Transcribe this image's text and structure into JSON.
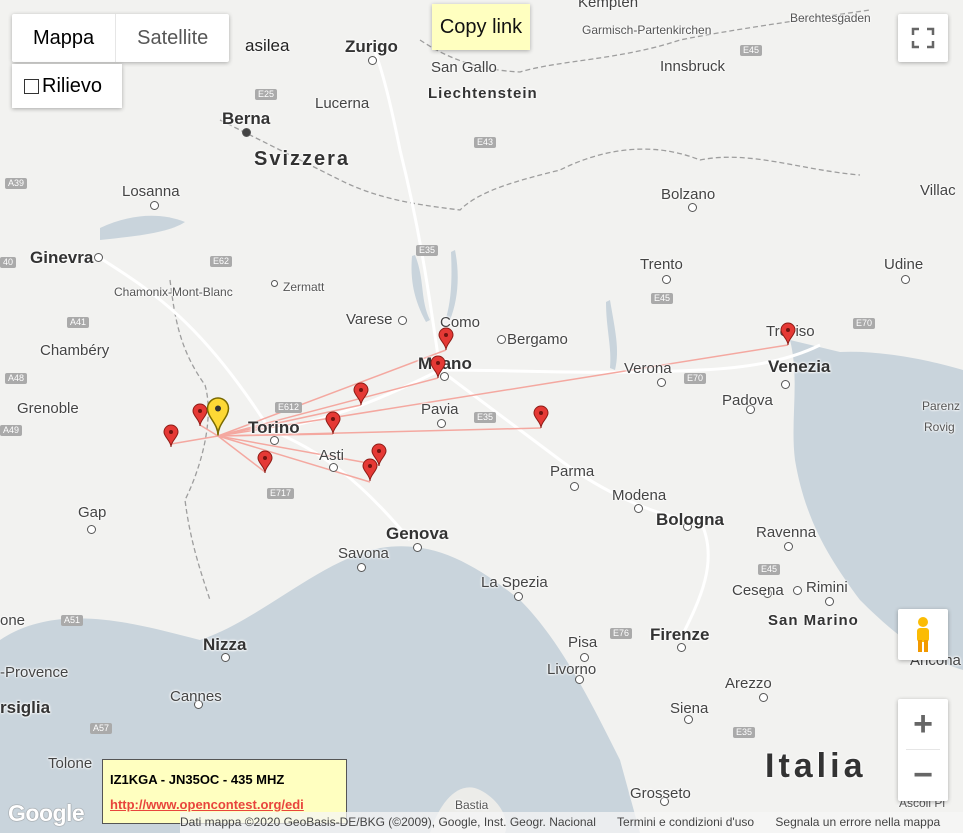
{
  "map_type": {
    "map_label": "Mappa",
    "satellite_label": "Satellite",
    "selected": "Mappa"
  },
  "terrain": {
    "label": "Rilievo",
    "checked": false
  },
  "copy_link": "Copy link",
  "info": {
    "title": "IZ1KGA - JN35OC - 435 MHZ",
    "link": "http://www.opencontest.org/edi"
  },
  "logo": "Google",
  "attribution": {
    "data": "Dati mappa ©2020 GeoBasis-DE/BKG (©2009), Google, Inst. Geogr. Nacional",
    "terms": "Termini e condizioni d'uso",
    "report": "Segnala un errore nella mappa"
  },
  "controls": {
    "zoom_in": "+",
    "zoom_out": "−"
  },
  "colors": {
    "info_bg": "#ffffc0",
    "link": "#e8453c",
    "marker_red": "#e53935",
    "marker_home": "#fdd835",
    "path": "#f4a8a0",
    "sea": "#c9d4dc"
  },
  "labels": {
    "kempten": "Kempten",
    "berchtesgaden": "Berchtesgaden",
    "basilea": "asilea",
    "zurigo": "Zurigo",
    "garmisch": "Garmisch-Partenkirchen",
    "sangallo": "San Gallo",
    "innsbruck": "Innsbruck",
    "liechtenstein": "Liechtenstein",
    "berna": "Berna",
    "lucerna": "Lucerna",
    "svizzera": "Svizzera",
    "losanna": "Losanna",
    "bolzano": "Bolzano",
    "villach": "Villac",
    "ginevra": "Ginevra",
    "trento": "Trento",
    "udine": "Udine",
    "chamonix": "Chamonix-Mont-Blanc",
    "zermatt": "Zermatt",
    "varese": "Varese",
    "como": "Como",
    "bergamo": "Bergamo",
    "treviso": "Treviso",
    "chambery": "Chambéry",
    "milano": "Milano",
    "verona": "Verona",
    "venezia": "Venezia",
    "grenoble": "Grenoble",
    "torino": "Torino",
    "pavia": "Pavia",
    "padova": "Padova",
    "parenzo": "Parenz",
    "rovigno": "Rovig",
    "asti": "Asti",
    "parma": "Parma",
    "modena": "Modena",
    "bologna": "Bologna",
    "gap": "Gap",
    "ravenna": "Ravenna",
    "genova": "Genova",
    "savona": "Savona",
    "laspezia": "La Spezia",
    "cesena": "Cesena",
    "rimini": "Rimini",
    "sanmarino": "San Marino",
    "firenze": "Firenze",
    "pisa": "Pisa",
    "ancona": "Ancona",
    "nizza": "Nizza",
    "provence": "-Provence",
    "livorno": "Livorno",
    "arezzo": "Arezzo",
    "cannes": "Cannes",
    "marsiglia": "rsiglia",
    "siena": "Siena",
    "italia": "Italia",
    "tolone": "Tolone",
    "grosseto": "Grosseto",
    "bastia": "Bastia",
    "ascoli": "Ascoli Pi",
    "eone": "one"
  },
  "roads": [
    "E45",
    "E25",
    "E43",
    "E35",
    "E62",
    "E45",
    "E70",
    "A39",
    "40",
    "A41",
    "A48",
    "A49",
    "E612",
    "E70",
    "E35",
    "E717",
    "E76",
    "A51",
    "E45",
    "A57",
    "E35"
  ]
}
